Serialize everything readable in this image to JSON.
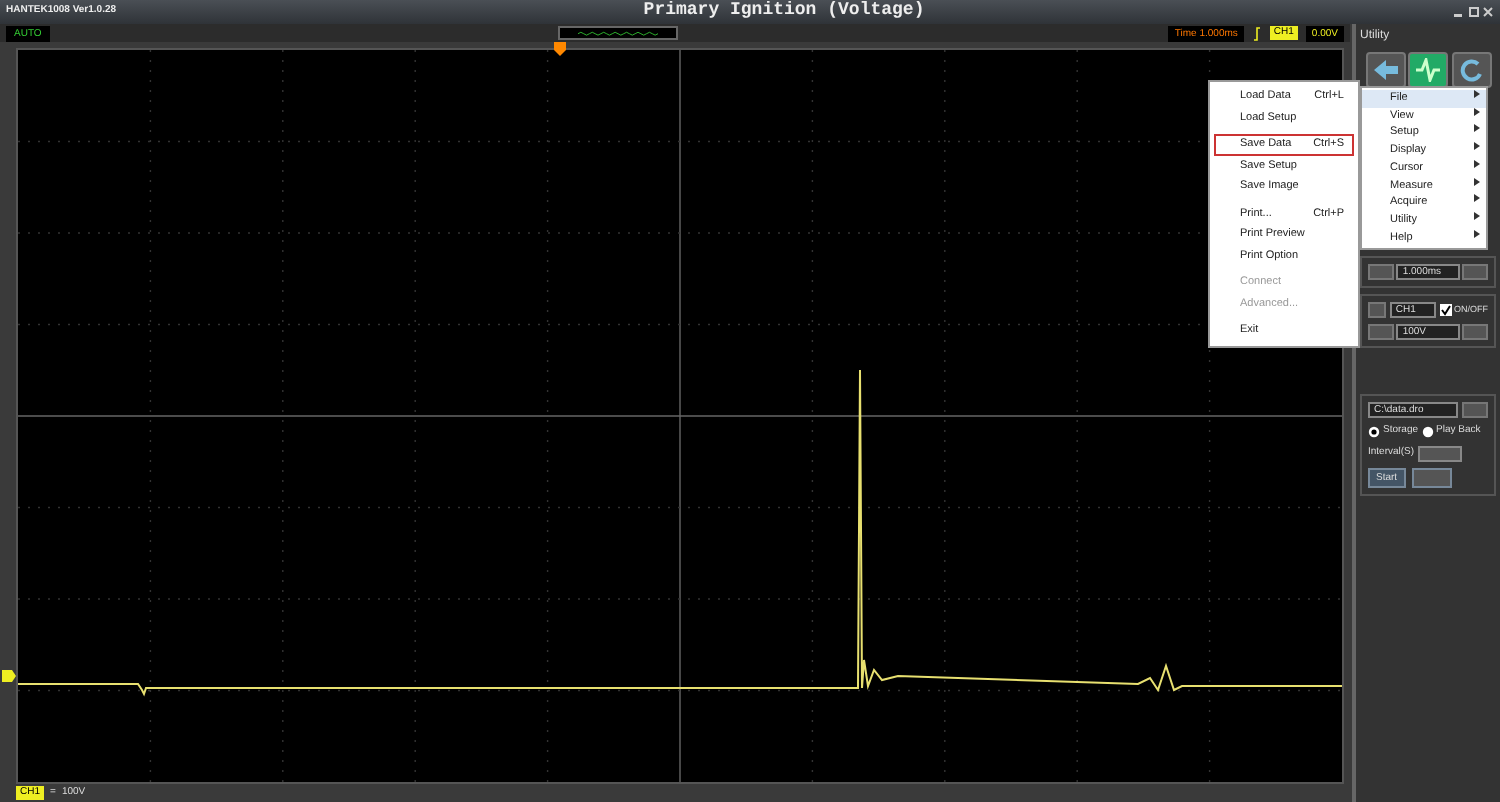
{
  "window": {
    "app_name": "HANTEK1008 Ver1.0.28",
    "title": "Primary Ignition (Voltage)"
  },
  "toolbar": {
    "mode": "AUTO",
    "time": "Time 1.000ms",
    "trigger_channel": "CH1",
    "trigger_level": "0.00V"
  },
  "status": {
    "channel": "CH1",
    "coupling": "=",
    "scale": "100V"
  },
  "utility": {
    "title": "Utility"
  },
  "menu": {
    "items": [
      {
        "kind": "item",
        "label": "Load Data",
        "shortcut": "Ctrl+L",
        "disabled": false,
        "selected": false
      },
      {
        "kind": "item",
        "label": "Load Setup",
        "disabled": false,
        "selected": false
      },
      {
        "kind": "separator"
      },
      {
        "kind": "item",
        "label": "Save Data",
        "shortcut": "Ctrl+S",
        "disabled": false,
        "selected": true
      },
      {
        "kind": "item",
        "label": "Save Setup",
        "disabled": false,
        "selected": false
      },
      {
        "kind": "item",
        "label": "Save Image",
        "disabled": false,
        "selected": false
      },
      {
        "kind": "separator"
      },
      {
        "kind": "item",
        "label": "Print...",
        "shortcut": "Ctrl+P",
        "disabled": false,
        "selected": false
      },
      {
        "kind": "item",
        "label": "Print Preview",
        "disabled": false,
        "selected": false
      },
      {
        "kind": "item",
        "label": "Print Option",
        "disabled": false,
        "selected": false
      },
      {
        "kind": "separator"
      },
      {
        "kind": "item",
        "label": "Connect",
        "disabled": true,
        "selected": false
      },
      {
        "kind": "item",
        "label": "Advanced...",
        "disabled": true,
        "selected": false
      },
      {
        "kind": "separator"
      },
      {
        "kind": "item",
        "label": "Exit",
        "disabled": false,
        "selected": false
      }
    ],
    "submenu": [
      {
        "label": "File",
        "selected": true
      },
      {
        "label": "View",
        "selected": false
      },
      {
        "label": "Setup",
        "selected": false
      },
      {
        "label": "Display",
        "selected": false
      },
      {
        "label": "Cursor",
        "selected": false
      },
      {
        "label": "Measure",
        "selected": false
      },
      {
        "label": "Acquire",
        "selected": false
      },
      {
        "label": "Utility",
        "selected": false
      },
      {
        "label": "Help",
        "selected": false
      }
    ]
  },
  "controls": {
    "timebase": "1.000ms",
    "channel": "CH1",
    "on_off": {
      "label": "ON/OFF",
      "checked": true
    },
    "volts": "100V",
    "path": "C:\\data.dro",
    "radios": [
      {
        "label": "Storage",
        "selected": true
      },
      {
        "label": "Play Back",
        "selected": false
      }
    ],
    "interval_label": "Interval(S)",
    "start": "Start"
  }
}
